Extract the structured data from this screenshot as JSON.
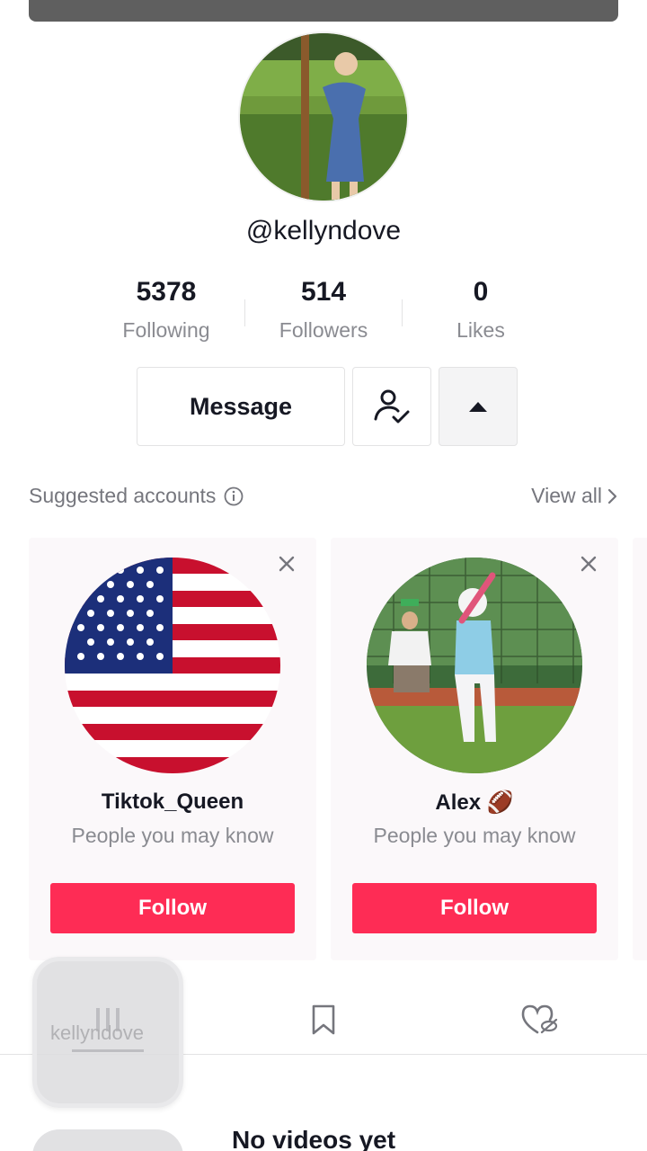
{
  "profile": {
    "username": "@kellyndove",
    "stats": [
      {
        "value": "5378",
        "label": "Following"
      },
      {
        "value": "514",
        "label": "Followers"
      },
      {
        "value": "0",
        "label": "Likes"
      }
    ],
    "message_label": "Message"
  },
  "suggested": {
    "title": "Suggested accounts",
    "view_all": "View all",
    "cards": [
      {
        "name": "Tiktok_Queen",
        "subtitle": "People you may know",
        "follow_label": "Follow"
      },
      {
        "name": "Alex 🏈",
        "subtitle": "People you may know",
        "follow_label": "Follow"
      }
    ]
  },
  "floating_label": "kellyndove",
  "empty_state": {
    "title": "No videos yet"
  },
  "colors": {
    "accent": "#fe2c55",
    "muted_text": "#8a8b91",
    "border": "#e3e3e4"
  }
}
